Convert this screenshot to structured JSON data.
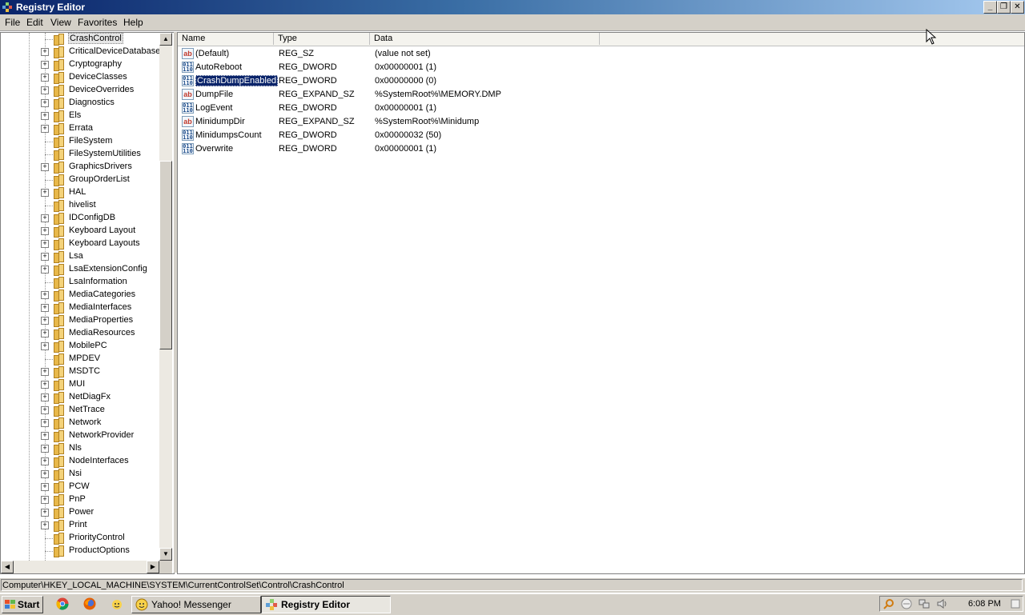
{
  "window": {
    "title": "Registry Editor"
  },
  "menu": [
    "File",
    "Edit",
    "View",
    "Favorites",
    "Help"
  ],
  "tree": {
    "items": [
      {
        "label": "CrashControl",
        "expandable": false,
        "selected": true
      },
      {
        "label": "CriticalDeviceDatabase",
        "expandable": true
      },
      {
        "label": "Cryptography",
        "expandable": true
      },
      {
        "label": "DeviceClasses",
        "expandable": true
      },
      {
        "label": "DeviceOverrides",
        "expandable": true
      },
      {
        "label": "Diagnostics",
        "expandable": true
      },
      {
        "label": "Els",
        "expandable": true
      },
      {
        "label": "Errata",
        "expandable": true
      },
      {
        "label": "FileSystem",
        "expandable": false
      },
      {
        "label": "FileSystemUtilities",
        "expandable": false
      },
      {
        "label": "GraphicsDrivers",
        "expandable": true
      },
      {
        "label": "GroupOrderList",
        "expandable": false
      },
      {
        "label": "HAL",
        "expandable": true
      },
      {
        "label": "hivelist",
        "expandable": false
      },
      {
        "label": "IDConfigDB",
        "expandable": true
      },
      {
        "label": "Keyboard Layout",
        "expandable": true
      },
      {
        "label": "Keyboard Layouts",
        "expandable": true
      },
      {
        "label": "Lsa",
        "expandable": true
      },
      {
        "label": "LsaExtensionConfig",
        "expandable": true
      },
      {
        "label": "LsaInformation",
        "expandable": false
      },
      {
        "label": "MediaCategories",
        "expandable": true
      },
      {
        "label": "MediaInterfaces",
        "expandable": true
      },
      {
        "label": "MediaProperties",
        "expandable": true
      },
      {
        "label": "MediaResources",
        "expandable": true
      },
      {
        "label": "MobilePC",
        "expandable": true
      },
      {
        "label": "MPDEV",
        "expandable": false
      },
      {
        "label": "MSDTC",
        "expandable": true
      },
      {
        "label": "MUI",
        "expandable": true
      },
      {
        "label": "NetDiagFx",
        "expandable": true
      },
      {
        "label": "NetTrace",
        "expandable": true
      },
      {
        "label": "Network",
        "expandable": true
      },
      {
        "label": "NetworkProvider",
        "expandable": true
      },
      {
        "label": "Nls",
        "expandable": true
      },
      {
        "label": "NodeInterfaces",
        "expandable": true
      },
      {
        "label": "Nsi",
        "expandable": true
      },
      {
        "label": "PCW",
        "expandable": true
      },
      {
        "label": "PnP",
        "expandable": true
      },
      {
        "label": "Power",
        "expandable": true
      },
      {
        "label": "Print",
        "expandable": true
      },
      {
        "label": "PriorityControl",
        "expandable": false
      },
      {
        "label": "ProductOptions",
        "expandable": false
      }
    ]
  },
  "list": {
    "columns": [
      "Name",
      "Type",
      "Data"
    ],
    "rows": [
      {
        "icon": "string-value-icon",
        "name": "(Default)",
        "type": "REG_SZ",
        "data": "(value not set)",
        "selected": false
      },
      {
        "icon": "binary-value-icon",
        "name": "AutoReboot",
        "type": "REG_DWORD",
        "data": "0x00000001 (1)",
        "selected": false
      },
      {
        "icon": "binary-value-icon",
        "name": "CrashDumpEnabled",
        "type": "REG_DWORD",
        "data": "0x00000000 (0)",
        "selected": true
      },
      {
        "icon": "string-value-icon",
        "name": "DumpFile",
        "type": "REG_EXPAND_SZ",
        "data": "%SystemRoot%\\MEMORY.DMP",
        "selected": false
      },
      {
        "icon": "binary-value-icon",
        "name": "LogEvent",
        "type": "REG_DWORD",
        "data": "0x00000001 (1)",
        "selected": false
      },
      {
        "icon": "string-value-icon",
        "name": "MinidumpDir",
        "type": "REG_EXPAND_SZ",
        "data": "%SystemRoot%\\Minidump",
        "selected": false
      },
      {
        "icon": "binary-value-icon",
        "name": "MinidumpsCount",
        "type": "REG_DWORD",
        "data": "0x00000032 (50)",
        "selected": false
      },
      {
        "icon": "binary-value-icon",
        "name": "Overwrite",
        "type": "REG_DWORD",
        "data": "0x00000001 (1)",
        "selected": false
      }
    ]
  },
  "status": {
    "path": "Computer\\HKEY_LOCAL_MACHINE\\SYSTEM\\CurrentControlSet\\Control\\CrashControl"
  },
  "taskbar": {
    "start_label": "Start",
    "quick_launch": [
      "chrome-icon",
      "firefox-icon",
      "yahoo-icon"
    ],
    "tasks": [
      {
        "label": "Yahoo! Messenger",
        "active": false
      },
      {
        "label": "Registry Editor",
        "active": true
      }
    ],
    "clock": "6:08 PM"
  },
  "colors": {
    "title_bar": "#0a246a",
    "selection": "#0a246a",
    "chrome": "#d4d0c8"
  }
}
